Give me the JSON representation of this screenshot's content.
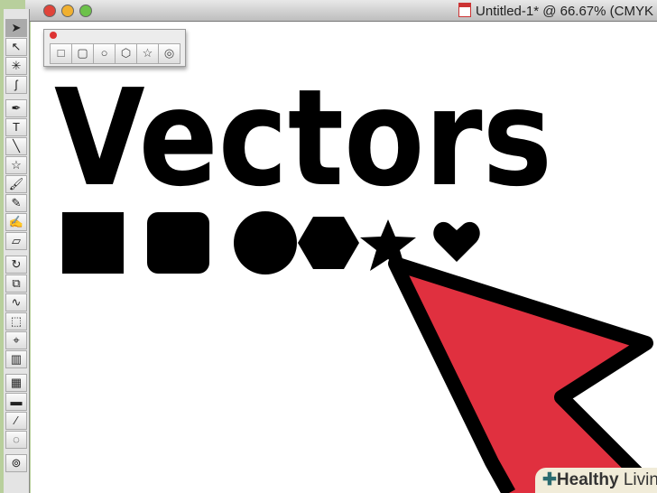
{
  "window": {
    "title": "Untitled-1* @ 66.67% (CMYK"
  },
  "tools": [
    {
      "name": "selection",
      "glyph": "➤"
    },
    {
      "name": "direct-selection",
      "glyph": "↖"
    },
    {
      "name": "magic-wand",
      "glyph": "✳"
    },
    {
      "name": "lasso",
      "glyph": "ʃ"
    },
    {
      "name": "pen",
      "glyph": "✒"
    },
    {
      "name": "type",
      "glyph": "T"
    },
    {
      "name": "line",
      "glyph": "╲"
    },
    {
      "name": "star",
      "glyph": "☆"
    },
    {
      "name": "paintbrush",
      "glyph": "🖌"
    },
    {
      "name": "pencil",
      "glyph": "✎"
    },
    {
      "name": "blob-brush",
      "glyph": "✍"
    },
    {
      "name": "eraser",
      "glyph": "▱"
    },
    {
      "name": "rotate",
      "glyph": "↻"
    },
    {
      "name": "scale",
      "glyph": "⧉"
    },
    {
      "name": "warp",
      "glyph": "∿"
    },
    {
      "name": "free-transform",
      "glyph": "⬚"
    },
    {
      "name": "shape-builder",
      "glyph": "⌖"
    },
    {
      "name": "graph",
      "glyph": "▥"
    },
    {
      "name": "mesh",
      "glyph": "▦"
    },
    {
      "name": "gradient",
      "glyph": "▬"
    },
    {
      "name": "eyedropper",
      "glyph": "⁄"
    },
    {
      "name": "blend",
      "glyph": "◌"
    },
    {
      "name": "symbol-sprayer",
      "glyph": "⊚"
    }
  ],
  "palette": {
    "items": [
      {
        "name": "rectangle",
        "glyph": "□"
      },
      {
        "name": "rounded-rectangle",
        "glyph": "▢"
      },
      {
        "name": "ellipse",
        "glyph": "○"
      },
      {
        "name": "polygon",
        "glyph": "⬡"
      },
      {
        "name": "star",
        "glyph": "☆"
      },
      {
        "name": "flare",
        "glyph": "◎"
      }
    ]
  },
  "artwork": {
    "headline": "Vectors",
    "arrow_color": "#e0303f"
  },
  "watermark": {
    "brand": "Healthy",
    "suffix": " Living"
  }
}
